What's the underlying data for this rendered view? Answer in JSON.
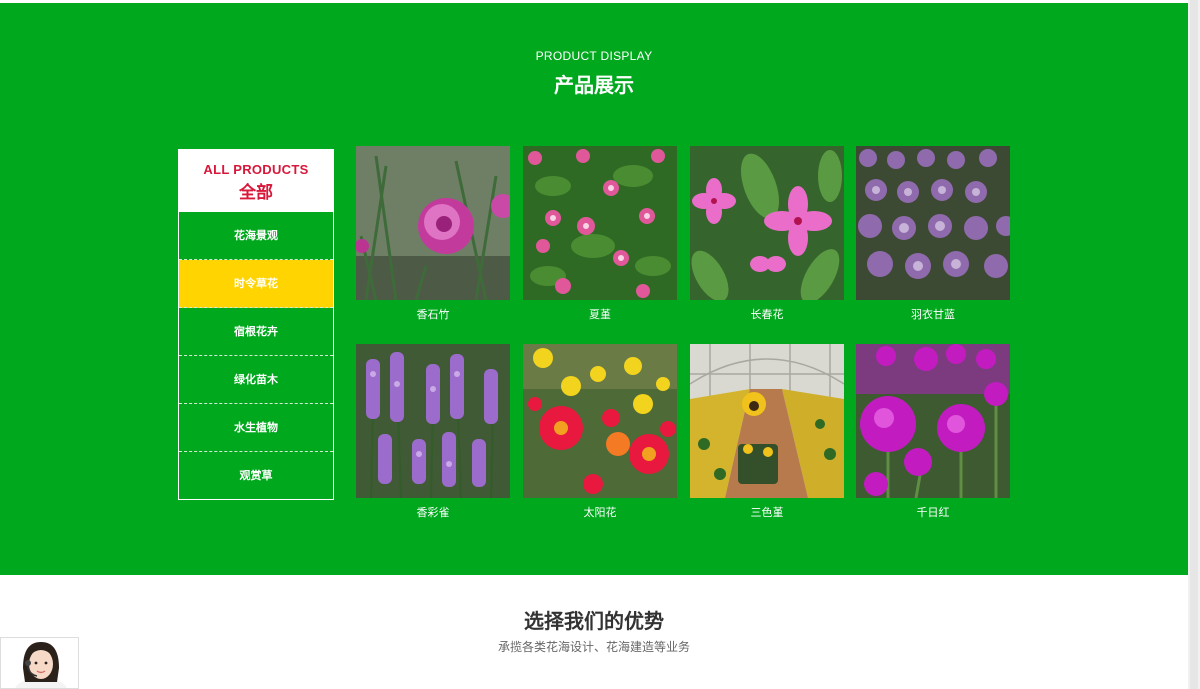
{
  "product_section": {
    "title_en": "PRODUCT DISPLAY",
    "title_cn": "产品展示"
  },
  "categories": {
    "all_en": "ALL PRODUCTS",
    "all_cn": "全部",
    "items": [
      {
        "label": "花海景观",
        "active": false
      },
      {
        "label": "时令草花",
        "active": true
      },
      {
        "label": "宿根花卉",
        "active": false
      },
      {
        "label": "绿化苗木",
        "active": false
      },
      {
        "label": "水生植物",
        "active": false
      },
      {
        "label": "观赏草",
        "active": false
      }
    ]
  },
  "products": [
    {
      "name": "香石竹"
    },
    {
      "name": "夏堇"
    },
    {
      "name": "长春花"
    },
    {
      "name": "羽衣甘蓝"
    },
    {
      "name": "香彩雀"
    },
    {
      "name": "太阳花"
    },
    {
      "name": "三色堇"
    },
    {
      "name": "千日红"
    }
  ],
  "advantages": {
    "title": "选择我们的优势",
    "subtitle": "承揽各类花海设计、花海建造等业务"
  },
  "colors": {
    "section_green": "#00a81d",
    "active_yellow": "#ffd400",
    "accent_red": "#d8173a"
  }
}
